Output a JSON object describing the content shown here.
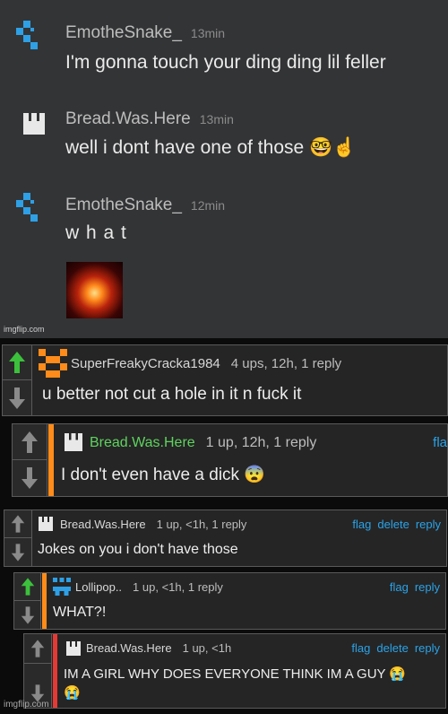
{
  "chat": {
    "messages": [
      {
        "user": "EmotheSnake_",
        "time": "13min",
        "text": "I'm gonna touch your ding ding lil feller"
      },
      {
        "user": "Bread.Was.Here",
        "time": "13min",
        "text": "well i dont have one of those 🤓☝️"
      },
      {
        "user": "EmotheSnake_",
        "time": "12min",
        "text": "w h a t"
      }
    ],
    "image_alt": "explosion-image",
    "watermark": "imgflip.com"
  },
  "comments": [
    {
      "user": "SuperFreakyCracka1984",
      "meta": "4 ups, 12h, 1 reply",
      "text": "u better not cut a hole in it n fuck it",
      "actions": [],
      "accent": ""
    },
    {
      "user": "Bread.Was.Here",
      "meta": "1 up, 12h, 1 reply",
      "text": "I don't even have a dick 😨",
      "actions": [
        "fla"
      ],
      "accent": "#ff8c1a"
    },
    {
      "user": "Bread.Was.Here",
      "meta": "1 up, <1h, 1 reply",
      "text": "Jokes on you i don't have those",
      "actions": [
        "flag",
        "delete",
        "reply"
      ],
      "accent": ""
    },
    {
      "user": "Lollipop..",
      "meta": "1 up, <1h, 1 reply",
      "text": "WHAT?!",
      "actions": [
        "flag",
        "reply"
      ],
      "accent": "#ff8c1a"
    },
    {
      "user": "Bread.Was.Here",
      "meta": "1 up, <1h",
      "text": "IM A GIRL WHY DOES EVERYONE THINK IM A GUY 😭",
      "text2": "😭",
      "actions": [
        "flag",
        "delete",
        "reply"
      ],
      "accent": "#e53935"
    }
  ],
  "footer_watermark": "imgflip.com",
  "colors": {
    "upvoted": "#3cc13c",
    "link": "#2aa3e8",
    "bread_green": "#5fd35f"
  }
}
